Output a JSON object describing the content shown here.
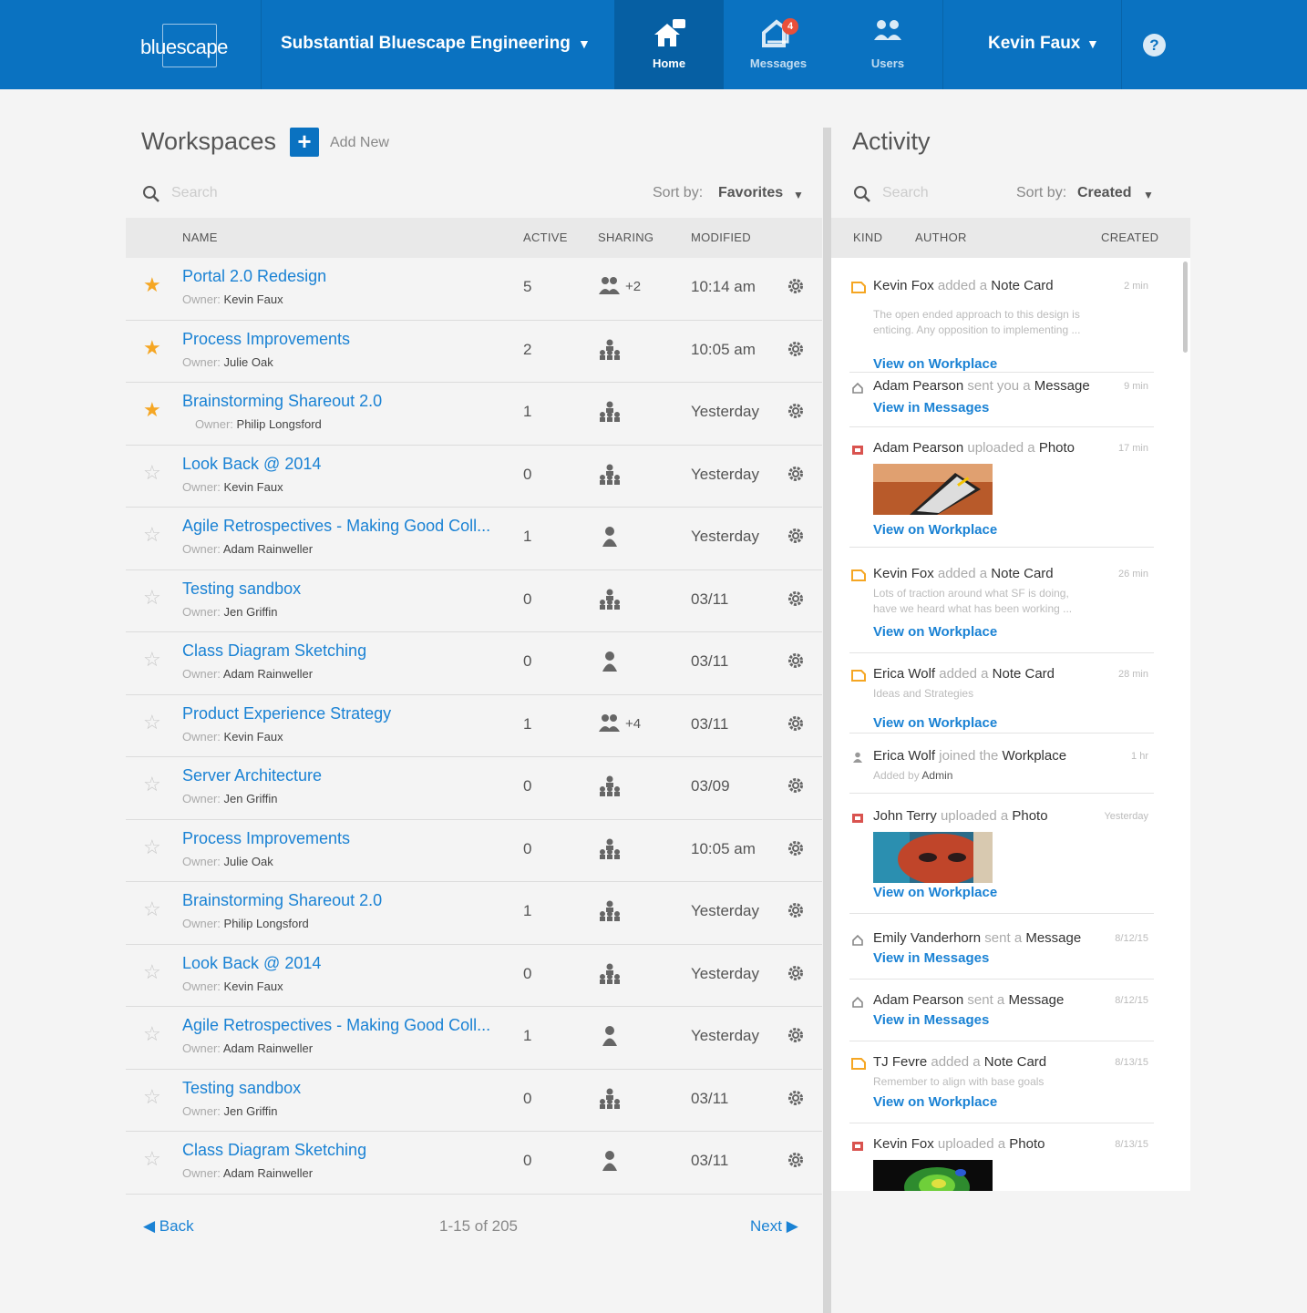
{
  "header": {
    "logo_text": "bluescape",
    "org_name": "Substantial Bluescape Engineering",
    "nav": [
      {
        "label": "Home",
        "icon": "home-icon",
        "active": true
      },
      {
        "label": "Messages",
        "icon": "messages-icon",
        "badge": "4"
      },
      {
        "label": "Users",
        "icon": "users-icon"
      }
    ],
    "user_name": "Kevin Faux",
    "help_label": "?"
  },
  "workspaces": {
    "title": "Workspaces",
    "add_label": "Add New",
    "search_placeholder": "Search",
    "sort_label": "Sort by:",
    "sort_value": "Favorites",
    "columns": {
      "name": "NAME",
      "active": "ACTIVE",
      "sharing": "SHARING",
      "modified": "MODIFIED"
    },
    "owner_label": "Owner:",
    "rows": [
      {
        "name": "Portal 2.0 Redesign",
        "owner": "Kevin Faux",
        "active": "5",
        "sharing": "group",
        "share_count": "+2",
        "modified": "10:14 am",
        "favorite": true
      },
      {
        "name": "Process Improvements",
        "owner": "Julie Oak",
        "active": "2",
        "sharing": "org",
        "share_count": "",
        "modified": "10:05 am",
        "favorite": true
      },
      {
        "name": "Brainstorming Shareout 2.0",
        "owner": "Philip Longsford",
        "active": "1",
        "sharing": "org",
        "share_count": "",
        "modified": "Yesterday",
        "favorite": true
      },
      {
        "name": "Look Back @ 2014",
        "owner": "Kevin Faux",
        "active": "0",
        "sharing": "org",
        "share_count": "",
        "modified": "Yesterday",
        "favorite": false
      },
      {
        "name": "Agile Retrospectives - Making Good Coll...",
        "owner": "Adam Rainweller",
        "active": "1",
        "sharing": "single",
        "share_count": "",
        "modified": "Yesterday",
        "favorite": false
      },
      {
        "name": "Testing sandbox",
        "owner": "Jen Griffin",
        "active": "0",
        "sharing": "org",
        "share_count": "",
        "modified": "03/11",
        "favorite": false
      },
      {
        "name": "Class Diagram Sketching",
        "owner": "Adam Rainweller",
        "active": "0",
        "sharing": "single",
        "share_count": "",
        "modified": "03/11",
        "favorite": false
      },
      {
        "name": "Product Experience Strategy",
        "owner": "Kevin Faux",
        "active": "1",
        "sharing": "group",
        "share_count": "+4",
        "modified": "03/11",
        "favorite": false
      },
      {
        "name": "Server Architecture",
        "owner": "Jen Griffin",
        "active": "0",
        "sharing": "org",
        "share_count": "",
        "modified": "03/09",
        "favorite": false
      },
      {
        "name": "Process Improvements",
        "owner": "Julie Oak",
        "active": "0",
        "sharing": "org",
        "share_count": "",
        "modified": "10:05 am",
        "favorite": false
      },
      {
        "name": "Brainstorming Shareout 2.0",
        "owner": "Philip Longsford",
        "active": "1",
        "sharing": "org",
        "share_count": "",
        "modified": "Yesterday",
        "favorite": false
      },
      {
        "name": "Look Back @ 2014",
        "owner": "Kevin Faux",
        "active": "0",
        "sharing": "org",
        "share_count": "",
        "modified": "Yesterday",
        "favorite": false
      },
      {
        "name": "Agile Retrospectives - Making Good Coll...",
        "owner": "Adam Rainweller",
        "active": "1",
        "sharing": "single",
        "share_count": "",
        "modified": "Yesterday",
        "favorite": false
      },
      {
        "name": "Testing sandbox",
        "owner": "Jen Griffin",
        "active": "0",
        "sharing": "org",
        "share_count": "",
        "modified": "03/11",
        "favorite": false
      },
      {
        "name": "Class Diagram Sketching",
        "owner": "Adam Rainweller",
        "active": "0",
        "sharing": "single",
        "share_count": "",
        "modified": "03/11",
        "favorite": false
      }
    ],
    "pager": {
      "back": "Back",
      "info": "1-15 of 205",
      "next": "Next"
    }
  },
  "activity": {
    "title": "Activity",
    "search_placeholder": "Search",
    "sort_label": "Sort by:",
    "sort_value": "Created",
    "columns": {
      "kind": "KIND",
      "author": "AUTHOR",
      "created": "CREATED"
    },
    "items": [
      {
        "kind": "note-card",
        "author": "Kevin Fox",
        "verb": "added a",
        "object": "Note Card",
        "time": "2 min",
        "desc": "The open ended approach to this design is enticing. Any opposition to implementing ...",
        "link": "View on Workplace"
      },
      {
        "kind": "message",
        "author": "Adam Pearson",
        "verb": "sent you a",
        "object": "Message",
        "time": "9 min",
        "link": "View in Messages"
      },
      {
        "kind": "photo",
        "author": "Adam Pearson",
        "verb": "uploaded a",
        "object": "Photo",
        "time": "17 min",
        "photo": "phone",
        "link": "View on Workplace"
      },
      {
        "kind": "note-card",
        "author": "Kevin Fox",
        "verb": "added a",
        "object": "Note Card",
        "time": "26 min",
        "desc": "Lots of traction around what SF is doing, have we heard what has been working ...",
        "link": "View on Workplace"
      },
      {
        "kind": "note-card",
        "author": "Erica Wolf",
        "verb": "added a",
        "object": "Note Card",
        "time": "28 min",
        "desc": "Ideas and Strategies",
        "link": "View on Workplace"
      },
      {
        "kind": "user",
        "author": "Erica Wolf",
        "verb": "joined the",
        "object": "Workplace",
        "time": "1 hr",
        "desc_prefix": "Added by",
        "desc_author": "Admin"
      },
      {
        "kind": "photo",
        "author": "John Terry",
        "verb": "uploaded a",
        "object": "Photo",
        "time": "Yesterday",
        "photo": "face",
        "link": "View on Workplace"
      },
      {
        "kind": "message",
        "author": "Emily Vanderhorn",
        "verb": "sent a",
        "object": "Message",
        "time": "8/12/15",
        "link": "View in Messages"
      },
      {
        "kind": "message",
        "author": "Adam Pearson",
        "verb": "sent a",
        "object": "Message",
        "time": "8/12/15",
        "link": "View in Messages"
      },
      {
        "kind": "note-card",
        "author": "TJ Fevre",
        "verb": "added a",
        "object": "Note Card",
        "time": "8/13/15",
        "desc": "Remember to align with base goals",
        "link": "View on Workplace"
      },
      {
        "kind": "photo",
        "author": "Kevin Fox",
        "verb": "uploaded a",
        "object": "Photo",
        "time": "8/13/15",
        "photo": "map"
      }
    ]
  },
  "colors": {
    "primary": "#0a72c1",
    "link": "#1a82d4",
    "star": "#f5a623",
    "note": "#f5a623",
    "photo": "#d9534f",
    "badge": "#e8503a"
  }
}
